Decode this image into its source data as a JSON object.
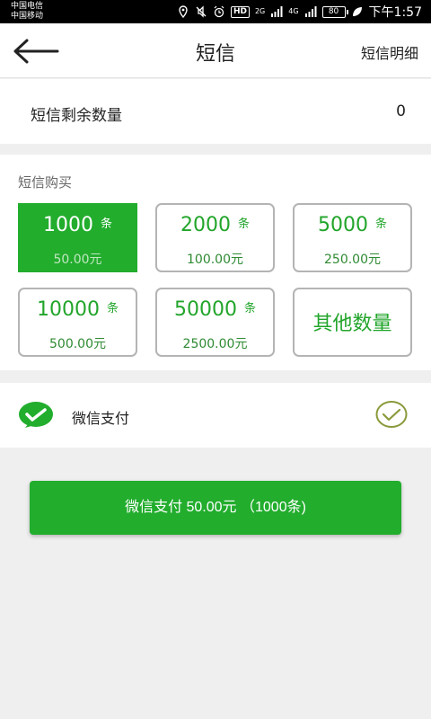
{
  "status_bar": {
    "carrier_1": "中国电信",
    "carrier_2": "中国移动",
    "hd": "HD",
    "network_1": "2G",
    "network_2": "4G",
    "battery": "80",
    "time": "下午1:57"
  },
  "nav": {
    "title": "短信",
    "right_label": "短信明细"
  },
  "remaining": {
    "label": "短信剩余数量",
    "value": "0"
  },
  "purchase": {
    "title": "短信购买",
    "unit": "条",
    "options": [
      {
        "count": "1000",
        "price": "50.00元",
        "selected": true
      },
      {
        "count": "2000",
        "price": "100.00元",
        "selected": false
      },
      {
        "count": "5000",
        "price": "250.00元",
        "selected": false
      },
      {
        "count": "10000",
        "price": "500.00元",
        "selected": false
      },
      {
        "count": "50000",
        "price": "2500.00元",
        "selected": false
      }
    ],
    "other_label": "其他数量"
  },
  "payment_method": {
    "label": "微信支付",
    "icon": "wechat-icon",
    "checked": true
  },
  "pay_button": {
    "label": "微信支付 50.00元 （1000条)"
  },
  "colors": {
    "accent": "#22ad2d",
    "option_text": "#22a52b",
    "border": "#b4b4b4",
    "background": "#efefef"
  }
}
